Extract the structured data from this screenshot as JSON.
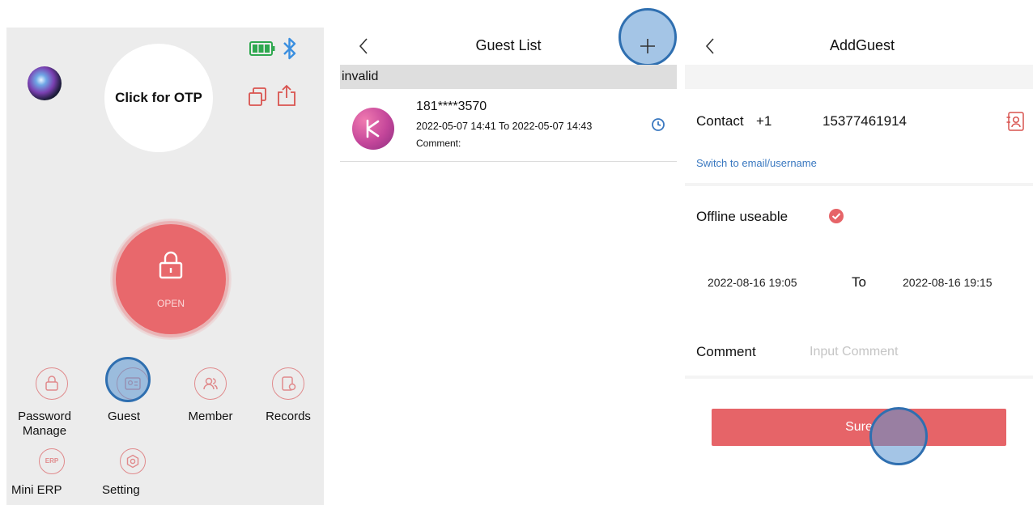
{
  "home": {
    "otp_label": "Click for OTP",
    "open_label": "OPEN",
    "menu": [
      {
        "label": "Password\nManage",
        "icon": "lock-icon"
      },
      {
        "label": "Guest",
        "icon": "id-card-icon"
      },
      {
        "label": "Member",
        "icon": "member-icon"
      },
      {
        "label": "Records",
        "icon": "records-icon"
      },
      {
        "label": "Mini ERP",
        "icon": "erp-icon"
      },
      {
        "label": "Setting",
        "icon": "gear-icon"
      }
    ]
  },
  "guest_list": {
    "title": "Guest List",
    "section": "invalid",
    "items": [
      {
        "phone": "181****3570",
        "period": "2022-05-07 14:41 To 2022-05-07 14:43",
        "comment": "Comment:"
      }
    ]
  },
  "add_guest": {
    "title": "AddGuest",
    "contact_label": "Contact",
    "country_code": "+1",
    "phone": "15377461914",
    "switch_link": "Switch to email/username",
    "offline_label": "Offline useable",
    "start": "2022-08-16 19:05",
    "to": "To",
    "end": "2022-08-16 19:15",
    "comment_label": "Comment",
    "comment_placeholder": "Input Comment",
    "sure_label": "Sure"
  },
  "colors": {
    "accent_red": "#e8686c",
    "tap_blue": "#2f6fb0",
    "link_blue": "#3a78c0"
  }
}
